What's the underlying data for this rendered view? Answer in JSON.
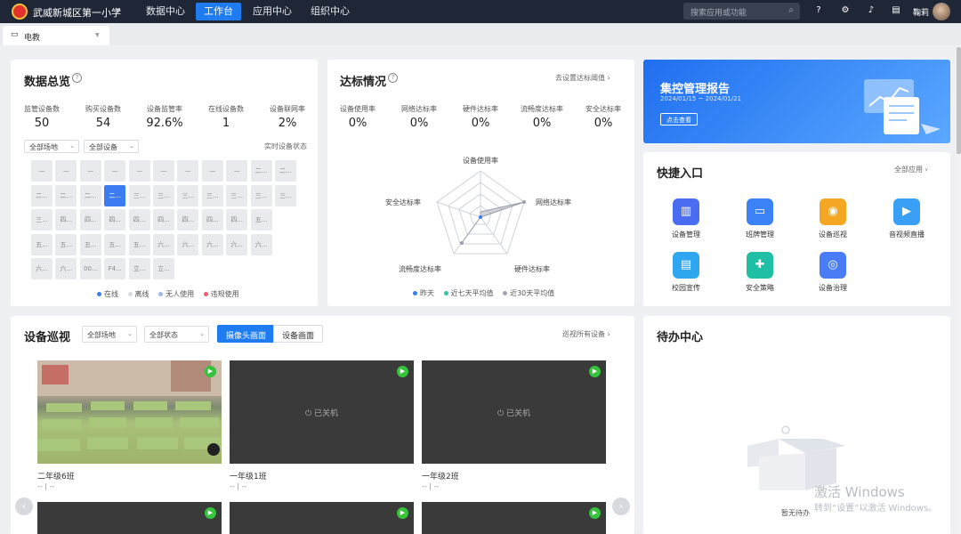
{
  "topbar": {
    "school_name": "武威新城区第一小学",
    "nav": [
      "数据中心",
      "工作台",
      "应用中心",
      "组织中心"
    ],
    "active_nav_index": 1,
    "search_placeholder": "搜索应用或功能",
    "username": "鞠莉"
  },
  "tabs": [
    {
      "label": "电教"
    }
  ],
  "overview": {
    "title": "数据总览",
    "stats": [
      {
        "label": "监管设备数",
        "value": "50"
      },
      {
        "label": "购买设备数",
        "value": "54"
      },
      {
        "label": "设备监管率",
        "value": "92.6%"
      },
      {
        "label": "在线设备数",
        "value": "1"
      },
      {
        "label": "设备联网率",
        "value": "2%"
      }
    ],
    "filter_site": "全部场地",
    "filter_device": "全部设备",
    "realtime_label": "实时设备状态",
    "grid": [
      [
        "—",
        "—",
        "—",
        "—",
        "—",
        "—",
        "—",
        "—",
        "—",
        "二...",
        "二..."
      ],
      [
        "二...",
        "二...",
        "二...",
        "二...",
        "三...",
        "三...",
        "三...",
        "三...",
        "三...",
        "三...",
        "三..."
      ],
      [
        "三...",
        "四...",
        "四...",
        "四...",
        "四...",
        "四...",
        "四...",
        "四...",
        "四...",
        "五..."
      ],
      [
        "五...",
        "五...",
        "五...",
        "五...",
        "五...",
        "六...",
        "六...",
        "六...",
        "六...",
        "六..."
      ],
      [
        "六...",
        "六...",
        "00...",
        "F4...",
        "立...",
        "立..."
      ]
    ],
    "selected_tile": [
      1,
      3
    ],
    "legend": [
      {
        "label": "在线",
        "color": "#3b7cf0"
      },
      {
        "label": "离线",
        "color": "#d9dce2"
      },
      {
        "label": "无人使用",
        "color": "#9fb8e8"
      },
      {
        "label": "违规使用",
        "color": "#f05a6e"
      }
    ]
  },
  "compliance": {
    "title": "达标情况",
    "link": "去设置达标阈值",
    "stats": [
      {
        "label": "设备使用率",
        "value": "0%"
      },
      {
        "label": "网络达标率",
        "value": "0%"
      },
      {
        "label": "硬件达标率",
        "value": "0%"
      },
      {
        "label": "流畅度达标率",
        "value": "0%"
      },
      {
        "label": "安全达标率",
        "value": "0%"
      }
    ],
    "radar_axes": [
      "设备使用率",
      "网络达标率",
      "硬件达标率",
      "流畅度达标率",
      "安全达标率"
    ],
    "legend": [
      {
        "label": "昨天",
        "color": "#3b7cf0"
      },
      {
        "label": "近七天平均值",
        "color": "#2bc8a0"
      },
      {
        "label": "近30天平均值",
        "color": "#a0a4ab"
      }
    ]
  },
  "banner": {
    "title": "集控管理报告",
    "date_range": "2024/01/15 ~ 2024/01/21",
    "button": "点击查看"
  },
  "shortcuts": {
    "title": "快捷入口",
    "link": "全部应用",
    "items": [
      {
        "label": "设备管理",
        "icon": "device-management-icon",
        "color": "#4a6cf0"
      },
      {
        "label": "班牌管理",
        "icon": "class-board-icon",
        "color": "#3b82f6"
      },
      {
        "label": "设备巡视",
        "icon": "device-patrol-icon",
        "color": "#f5a623"
      },
      {
        "label": "音视频直播",
        "icon": "live-video-icon",
        "color": "#3aa0f5"
      },
      {
        "label": "校园宣传",
        "icon": "campus-promo-icon",
        "color": "#2fa6f0"
      },
      {
        "label": "安全策略",
        "icon": "security-policy-icon",
        "color": "#1fbfa5"
      },
      {
        "label": "设备治理",
        "icon": "device-governance-icon",
        "color": "#4a7cf5"
      }
    ]
  },
  "patrol": {
    "title": "设备巡视",
    "filter_site": "全部场地",
    "filter_status": "全部状态",
    "toggle": [
      "摄像头画面",
      "设备画面"
    ],
    "toggle_active": 0,
    "link": "巡视所有设备",
    "cameras": [
      {
        "name": "二年级6班",
        "sub": "-- | --",
        "off": ""
      },
      {
        "name": "一年级1班",
        "sub": "-- | --",
        "off": "已关机"
      },
      {
        "name": "一年级2班",
        "sub": "-- | --",
        "off": "已关机"
      }
    ]
  },
  "todo": {
    "title": "待办中心",
    "empty": "暂无待办"
  },
  "watermark": {
    "line1": "激活 Windows",
    "line2": "转到“设置”以激活 Windows。"
  }
}
